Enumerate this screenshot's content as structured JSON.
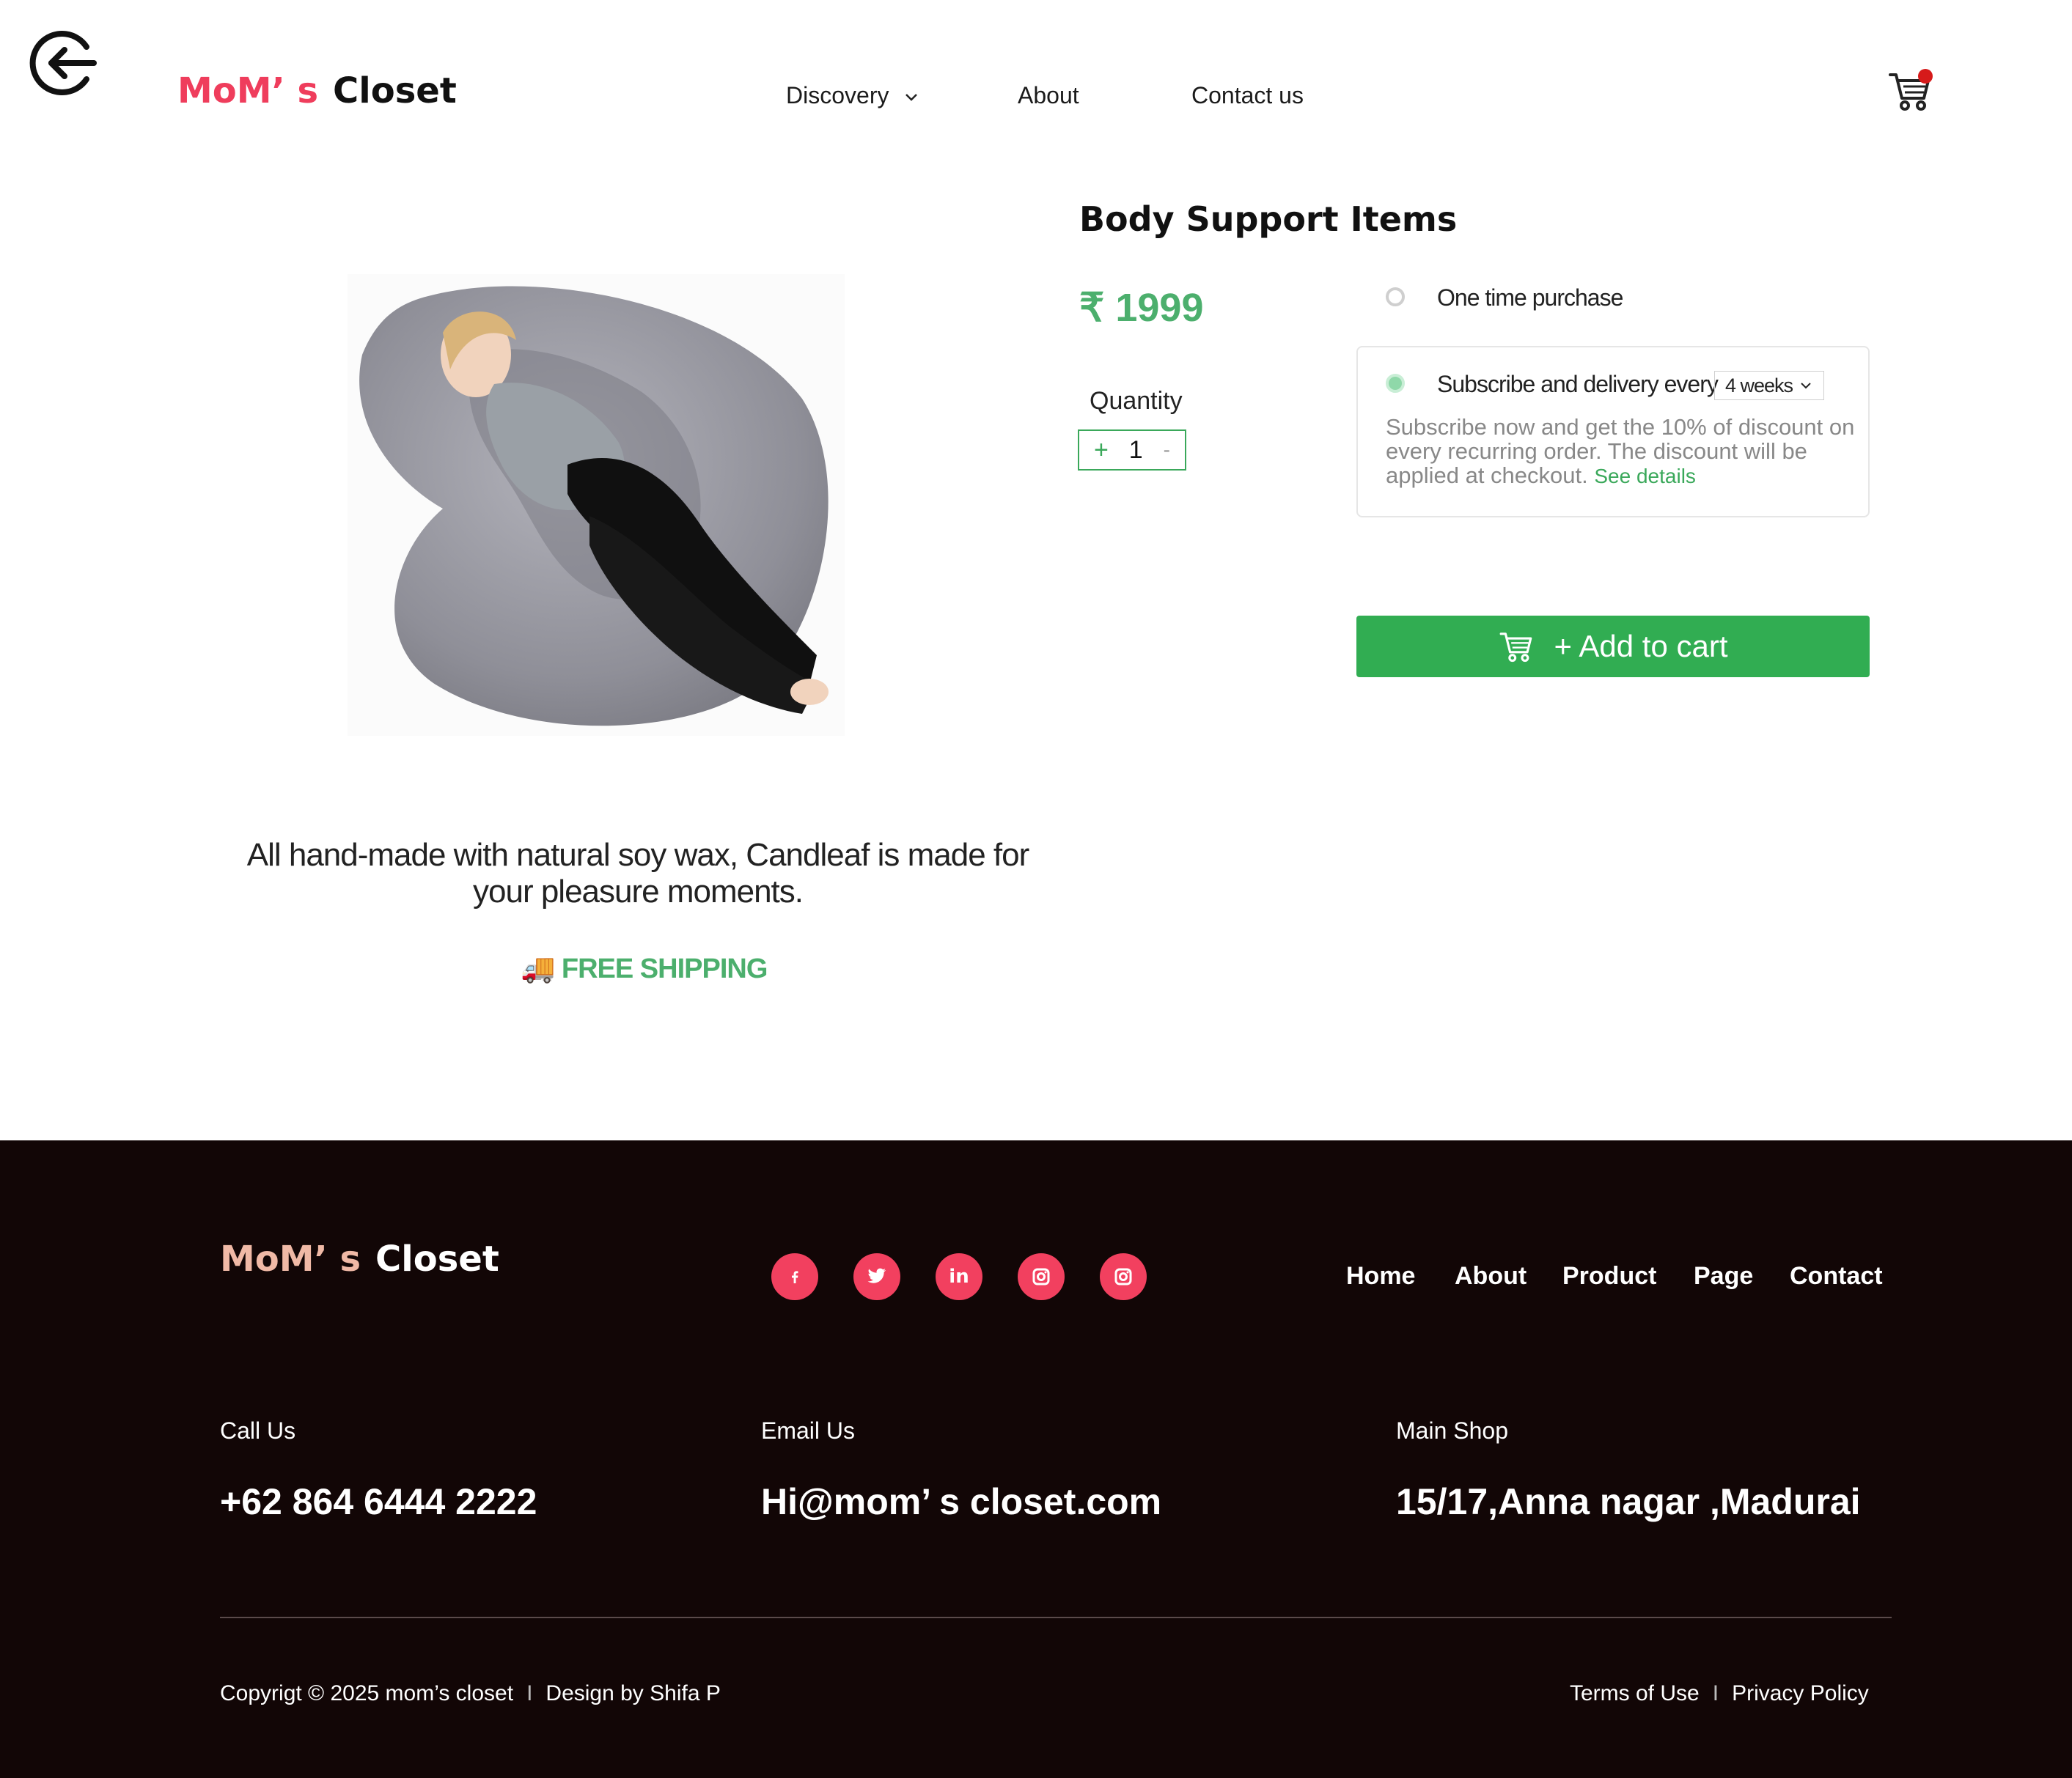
{
  "header": {
    "logo_part1": "MoM’ s",
    "logo_part2": "Closet",
    "nav": {
      "discovery": "Discovery",
      "about": "About",
      "contact": "Contact us"
    }
  },
  "product": {
    "title": "Body Support Items",
    "price": "₹ 1999",
    "quantity_label": "Quantity",
    "quantity_plus": "+",
    "quantity_value": "1",
    "quantity_minus": "-",
    "purchase_options": {
      "one_time": "One time purchase",
      "subscribe": "Subscribe and delivery every",
      "interval": "4 weeks",
      "selected": "subscribe",
      "description": "Subscribe now and get the 10% of discount on every recurring order.  The discount will be applied at checkout.",
      "see_details": "See details"
    },
    "add_to_cart": "+ Add to cart",
    "tagline": "All hand-made with natural soy wax, Candleaf is made for your pleasure moments.",
    "shipping_icon": "🚚",
    "free_shipping": "FREE SHIPPING"
  },
  "footer": {
    "logo_part1": "MoM’ s",
    "logo_part2": "Closet",
    "social": [
      "facebook-icon",
      "twitter-icon",
      "linkedin-icon",
      "instagram-icon",
      "instagram-icon"
    ],
    "nav": [
      "Home",
      "About",
      "Product",
      "Page",
      "Contact"
    ],
    "contacts": {
      "call_label": "Call Us",
      "call_value": "+62 864 6444 2222",
      "email_label": "Email Us",
      "email_value": "Hi@mom’ s  closet.com",
      "shop_label": "Main Shop",
      "shop_value": "15/17,Anna nagar ,Madurai"
    },
    "copyright": "Copyrigt © 2025 mom’s closet",
    "separator": "I",
    "design": "Design by Shifa P",
    "terms": "Terms of Use",
    "privacy": "Privacy Policy"
  },
  "colors": {
    "brand_pink": "#ef3d5c",
    "price_green": "#4caf6d",
    "button_green": "#31ad52",
    "footer_bg": "#120606",
    "footer_logo_peach": "#f0b9a6",
    "social_pink": "#f2405f"
  }
}
